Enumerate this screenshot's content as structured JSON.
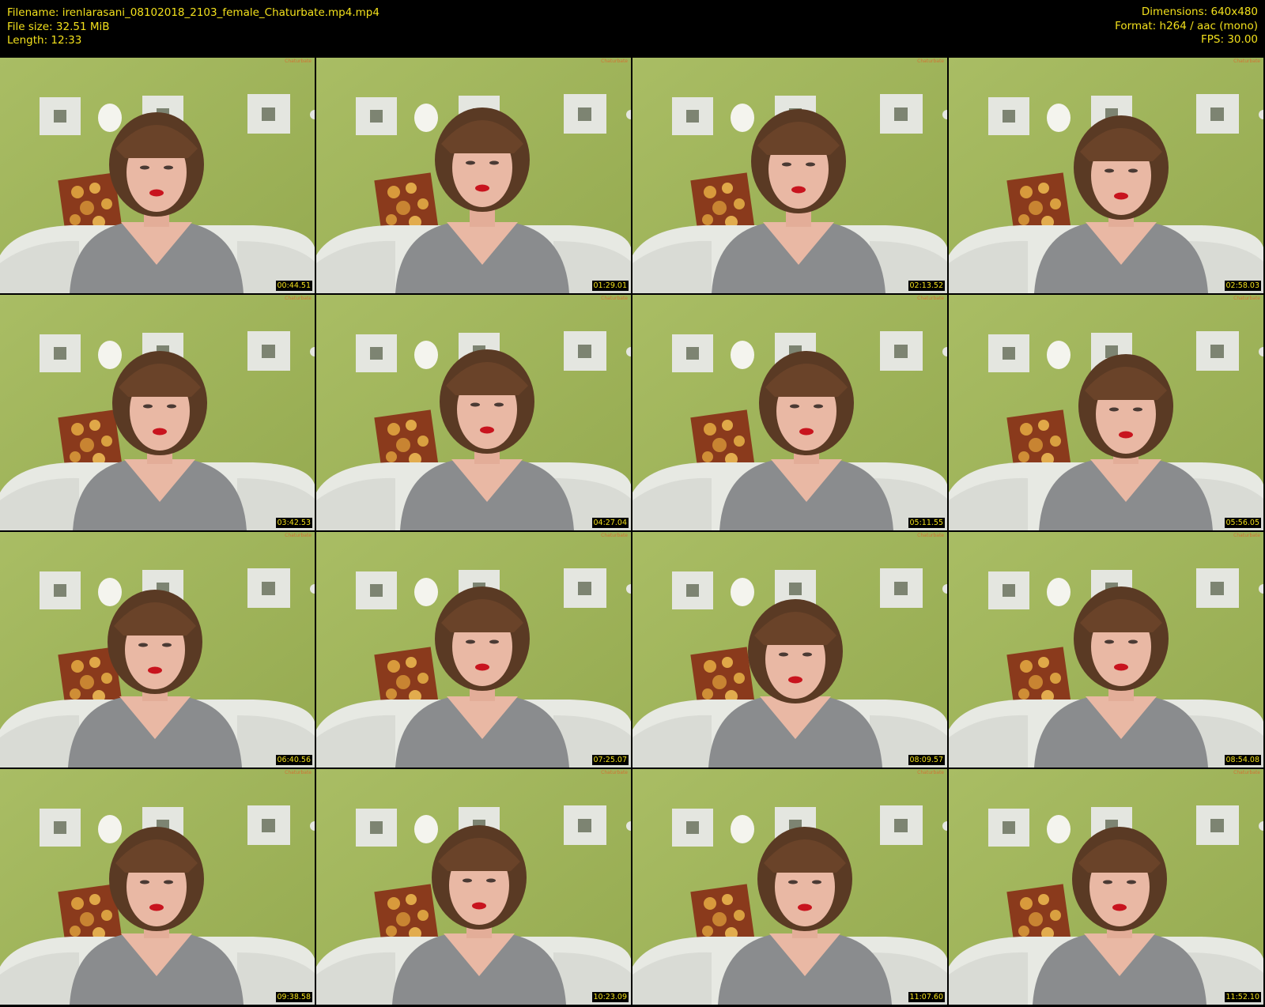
{
  "header": {
    "filename_line": "Filename: irenlarasani_08102018_2103_female_Chaturbate.mp4.mp4",
    "filesize_line": "File size: 32.51 MiB",
    "length_line": "Length: 12:33",
    "dimensions_line": "Dimensions: 640x480",
    "format_line": "Format: h264 / aac (mono)",
    "fps_line": "FPS: 30.00"
  },
  "colors": {
    "header_text": "#f2e01c",
    "background": "#000000",
    "wall": "#a4b860",
    "sofa": "#e6e8e2",
    "sweater": "#8a8c8e",
    "hair": "#5a3a24",
    "skin": "#e9b8a4",
    "lips": "#c8141e"
  },
  "thumbnails": [
    {
      "timestamp": "00:44.51",
      "watermark": "Chaturbate",
      "icon": "video-frame-thumbnail"
    },
    {
      "timestamp": "01:29.01",
      "watermark": "Chaturbate",
      "icon": "video-frame-thumbnail"
    },
    {
      "timestamp": "02:13.52",
      "watermark": "Chaturbate",
      "icon": "video-frame-thumbnail"
    },
    {
      "timestamp": "02:58.03",
      "watermark": "Chaturbate",
      "icon": "video-frame-thumbnail"
    },
    {
      "timestamp": "03:42.53",
      "watermark": "Chaturbate",
      "icon": "video-frame-thumbnail"
    },
    {
      "timestamp": "04:27.04",
      "watermark": "Chaturbate",
      "icon": "video-frame-thumbnail"
    },
    {
      "timestamp": "05:11.55",
      "watermark": "Chaturbate",
      "icon": "video-frame-thumbnail"
    },
    {
      "timestamp": "05:56.05",
      "watermark": "Chaturbate",
      "icon": "video-frame-thumbnail"
    },
    {
      "timestamp": "06:40.56",
      "watermark": "Chaturbate",
      "icon": "video-frame-thumbnail"
    },
    {
      "timestamp": "07:25.07",
      "watermark": "Chaturbate",
      "icon": "video-frame-thumbnail"
    },
    {
      "timestamp": "08:09.57",
      "watermark": "Chaturbate",
      "icon": "video-frame-thumbnail"
    },
    {
      "timestamp": "08:54.08",
      "watermark": "Chaturbate",
      "icon": "video-frame-thumbnail"
    },
    {
      "timestamp": "09:38.58",
      "watermark": "Chaturbate",
      "icon": "video-frame-thumbnail"
    },
    {
      "timestamp": "10:23.09",
      "watermark": "Chaturbate",
      "icon": "video-frame-thumbnail"
    },
    {
      "timestamp": "11:07.60",
      "watermark": "Chaturbate",
      "icon": "video-frame-thumbnail"
    },
    {
      "timestamp": "11:52.10",
      "watermark": "Chaturbate",
      "icon": "video-frame-thumbnail"
    }
  ]
}
